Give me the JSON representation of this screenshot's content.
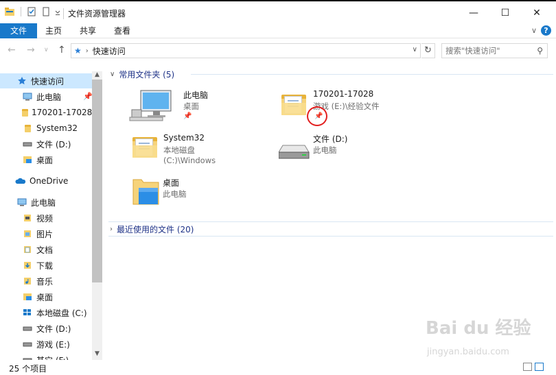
{
  "window": {
    "title": "文件资源管理器",
    "controls": {
      "minimize": "—",
      "maximize": "☐",
      "close": "✕"
    }
  },
  "ribbon": {
    "tabs": [
      {
        "label": "文件",
        "active": true
      },
      {
        "label": "主页",
        "active": false
      },
      {
        "label": "共享",
        "active": false
      },
      {
        "label": "查看",
        "active": false
      }
    ],
    "help_label": "?"
  },
  "address": {
    "crumb": "快速访问",
    "search_placeholder": "搜索\"快速访问\""
  },
  "nav": {
    "items": [
      {
        "label": "快速访问",
        "icon": "star-pin-icon"
      },
      {
        "label": "此电脑",
        "icon": "computer-icon"
      },
      {
        "label": "170201-17028",
        "icon": "folder-icon"
      },
      {
        "label": "System32",
        "icon": "folder-icon"
      },
      {
        "label": "文件 (D:)",
        "icon": "drive-icon"
      },
      {
        "label": "桌面",
        "icon": "desktop-folder-icon"
      },
      {
        "label": "OneDrive",
        "icon": "cloud-icon"
      },
      {
        "label": "此电脑",
        "icon": "computer-icon"
      },
      {
        "label": "视频",
        "icon": "video-folder-icon"
      },
      {
        "label": "图片",
        "icon": "picture-folder-icon"
      },
      {
        "label": "文档",
        "icon": "document-folder-icon"
      },
      {
        "label": "下载",
        "icon": "download-folder-icon"
      },
      {
        "label": "音乐",
        "icon": "music-folder-icon"
      },
      {
        "label": "桌面",
        "icon": "desktop-folder-icon"
      },
      {
        "label": "本地磁盘 (C:)",
        "icon": "windows-drive-icon"
      },
      {
        "label": "文件 (D:)",
        "icon": "drive-icon"
      },
      {
        "label": "游戏 (E:)",
        "icon": "drive-icon"
      },
      {
        "label": "其它 (F:)",
        "icon": "drive-icon"
      }
    ]
  },
  "content": {
    "frequent_header": "常用文件夹 (5)",
    "recent_header": "最近使用的文件 (20)",
    "folders": [
      {
        "name": "此电脑",
        "sub": "桌面",
        "icon": "computer-icon",
        "pinned": true
      },
      {
        "name": "170201-17028",
        "sub": "游戏 (E:)\\经验文件",
        "icon": "folder-icon",
        "pinned": true
      },
      {
        "name": "System32",
        "sub": "本地磁盘 (C:)\\Windows",
        "icon": "folder-icon",
        "pinned": false
      },
      {
        "name": "文件 (D:)",
        "sub": "此电脑",
        "icon": "drive-icon",
        "pinned": false
      },
      {
        "name": "桌面",
        "sub": "此电脑",
        "icon": "desktop-folder-icon",
        "pinned": false
      }
    ]
  },
  "status": {
    "item_count": "25 个项目"
  },
  "watermark": {
    "line1": "Bai du 经验",
    "line2": "jingyan.baidu.com"
  },
  "colors": {
    "accent": "#1979ca",
    "selection": "#cce8ff",
    "header_text": "#1e3287",
    "highlight_circle": "#e21e1e"
  }
}
